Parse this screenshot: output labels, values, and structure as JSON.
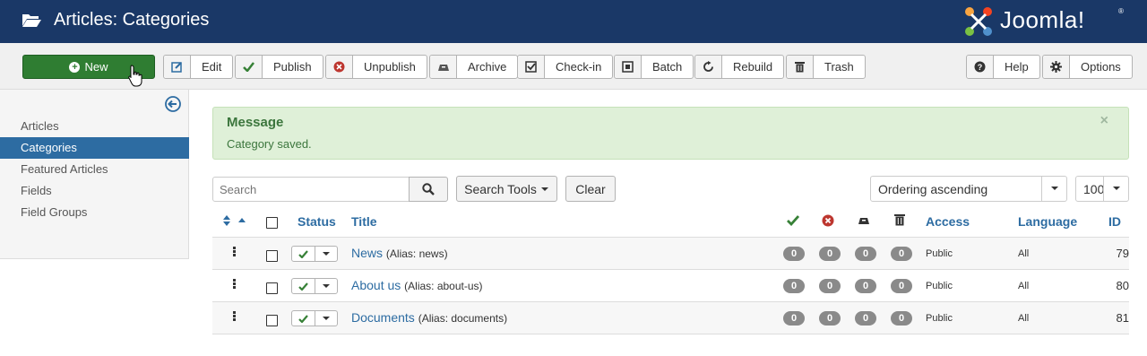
{
  "header": {
    "title": "Articles: Categories",
    "logo_text": "Joomla!",
    "logo_reg": "®",
    "bg": "#1a3867"
  },
  "toolbar": {
    "new": "New",
    "buttons": [
      {
        "label": "Edit",
        "icon": "edit-icon"
      },
      {
        "label": "Publish",
        "icon": "check-icon"
      },
      {
        "label": "Unpublish",
        "icon": "unpublish-icon"
      },
      {
        "label": "Archive",
        "icon": "archive-icon"
      },
      {
        "label": "Check-in",
        "icon": "checkin-icon"
      },
      {
        "label": "Batch",
        "icon": "batch-icon"
      },
      {
        "label": "Rebuild",
        "icon": "refresh-icon"
      },
      {
        "label": "Trash",
        "icon": "trash-icon"
      }
    ],
    "help": "Help",
    "options": "Options"
  },
  "sidebar": {
    "items": [
      {
        "label": "Articles",
        "active": false
      },
      {
        "label": "Categories",
        "active": true
      },
      {
        "label": "Featured Articles",
        "active": false
      },
      {
        "label": "Fields",
        "active": false
      },
      {
        "label": "Field Groups",
        "active": false
      }
    ]
  },
  "message": {
    "heading": "Message",
    "text": "Category saved.",
    "close": "×"
  },
  "filters": {
    "search_placeholder": "Search",
    "search_tools": "Search Tools",
    "clear": "Clear",
    "ordering": "Ordering ascending",
    "limit": "100"
  },
  "table": {
    "headers": {
      "status": "Status",
      "title": "Title",
      "access": "Access",
      "language": "Language",
      "id": "ID"
    },
    "rows": [
      {
        "title": "News",
        "alias": "(Alias: news)",
        "counts": [
          "0",
          "0",
          "0",
          "0"
        ],
        "access": "Public",
        "language": "All",
        "id": "79"
      },
      {
        "title": "About us",
        "alias": "(Alias: about-us)",
        "counts": [
          "0",
          "0",
          "0",
          "0"
        ],
        "access": "Public",
        "language": "All",
        "id": "80"
      },
      {
        "title": "Documents",
        "alias": "(Alias: documents)",
        "counts": [
          "0",
          "0",
          "0",
          "0"
        ],
        "access": "Public",
        "language": "All",
        "id": "81"
      }
    ]
  }
}
